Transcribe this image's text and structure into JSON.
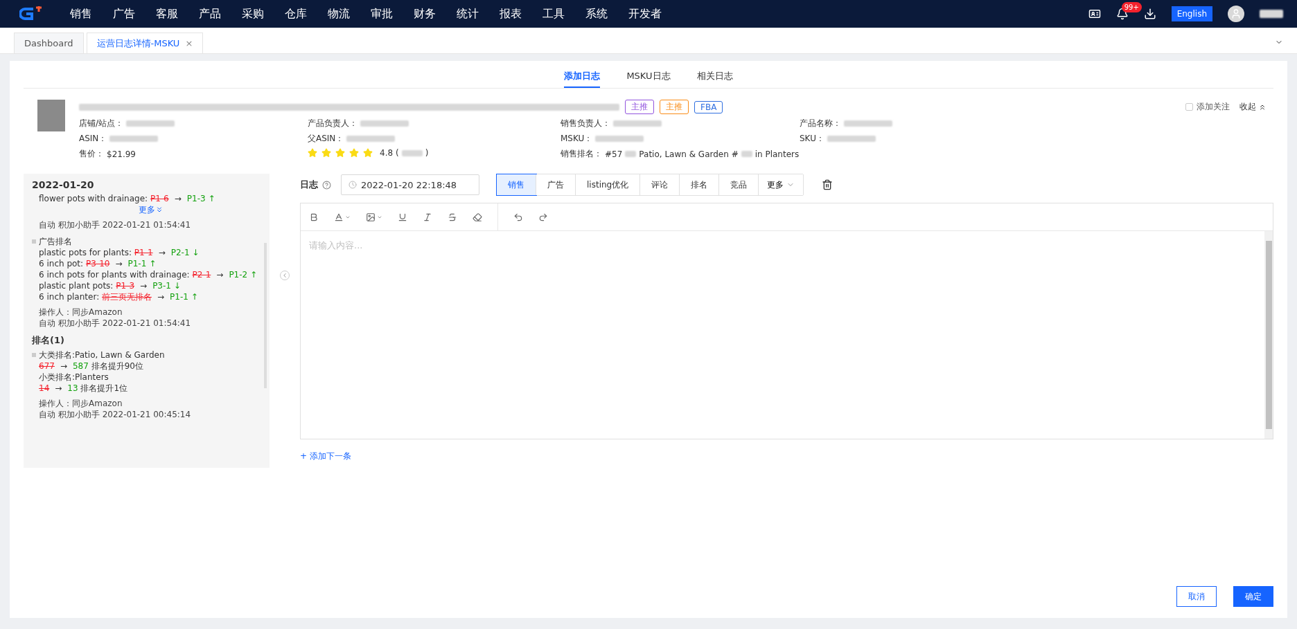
{
  "nav": {
    "menu": [
      "销售",
      "广告",
      "客服",
      "产品",
      "采购",
      "仓库",
      "物流",
      "审批",
      "财务",
      "统计",
      "报表",
      "工具",
      "系统",
      "开发者"
    ],
    "notification_badge": "99+",
    "language": "English"
  },
  "tabs": [
    {
      "label": "Dashboard",
      "selected": false,
      "closable": false
    },
    {
      "label": "运营日志详情-MSKU",
      "selected": true,
      "closable": true
    }
  ],
  "tab_close": "×",
  "subtabs": [
    {
      "label": "添加日志",
      "selected": true
    },
    {
      "label": "MSKU日志",
      "selected": false
    },
    {
      "label": "相关日志",
      "selected": false
    }
  ],
  "product": {
    "tags": [
      {
        "label": "主推",
        "color": "#9254de"
      },
      {
        "label": "主推",
        "color": "#fa8c16"
      },
      {
        "label": "FBA",
        "color": "#2f6fe0"
      }
    ],
    "follow": {
      "label": "添加关注",
      "checked": false
    },
    "collapse": "收起",
    "columns": [
      [
        {
          "label": "店铺/站点："
        },
        {
          "label": "ASIN："
        },
        {
          "label": "售价：",
          "value": "$21.99"
        }
      ],
      [
        {
          "label": "产品负责人："
        },
        {
          "label": "父ASIN："
        },
        {
          "kind": "rating",
          "stars": 5,
          "score": "4.8",
          "open": "(",
          "close": ")"
        }
      ],
      [
        {
          "label": "销售负责人："
        },
        {
          "label": "MSKU："
        },
        {
          "label": "销售排名：",
          "parts": [
            "#57",
            "Patio, Lawn & Garden #",
            "in Planters"
          ]
        }
      ],
      [
        {
          "label": "产品名称："
        },
        {
          "label": "SKU："
        }
      ]
    ]
  },
  "history": {
    "date": "2022-01-20",
    "groups": [
      {
        "lines": [
          {
            "label": "flower pots with drainage: ",
            "old": "P1-6",
            "arrow": "→",
            "new": "P1-3",
            "trend": "↑"
          }
        ],
        "more": "更多",
        "auto": "自动 积加小助手 2022-01-21 01:54:41"
      },
      {
        "title": "广告排名",
        "lines": [
          {
            "label": "plastic pots for plants: ",
            "old": "P1-1",
            "arrow": "→",
            "new": "P2-1",
            "trend": "↓"
          },
          {
            "label": "6 inch pot: ",
            "old": "P3-10",
            "arrow": "→",
            "new": "P1-1",
            "trend": "↑"
          },
          {
            "label": "6 inch pots for plants with drainage: ",
            "old": "P2-1",
            "arrow": "→",
            "new": "P1-2",
            "trend": "↑"
          },
          {
            "label": "plastic plant pots: ",
            "old": "P1-3",
            "arrow": "→",
            "new": "P3-1",
            "trend": "↓"
          },
          {
            "label": "6 inch planter: ",
            "old": "前三页无排名",
            "arrow": "→",
            "new": "P1-1",
            "trend": "↑"
          }
        ],
        "operator": "操作人：同步Amazon",
        "auto": "自动 积加小助手 2022-01-21 01:54:41"
      }
    ],
    "rank_title": "排名(1)",
    "ranks": [
      {
        "label": "大类排名:Patio, Lawn & Garden",
        "old": "677",
        "arrow": "→",
        "new": "587",
        "note": "排名提升90位"
      },
      {
        "label": "小类排名:Planters",
        "old": "14",
        "arrow": "→",
        "new": "13",
        "note": "排名提升1位"
      }
    ],
    "rank_operator": "操作人：同步Amazon",
    "rank_auto": "自动 积加小助手 2022-01-21 00:45:14"
  },
  "log": {
    "label": "日志",
    "datetime": "2022-01-20 22:18:48",
    "categories": [
      {
        "label": "销售",
        "selected": true
      },
      {
        "label": "广告",
        "selected": false
      },
      {
        "label": "listing优化",
        "selected": false
      },
      {
        "label": "评论",
        "selected": false
      },
      {
        "label": "排名",
        "selected": false
      },
      {
        "label": "竞品",
        "selected": false
      }
    ],
    "more": "更多",
    "placeholder": "请输入内容...",
    "add_next": "+ 添加下一条"
  },
  "buttons": [
    {
      "label": "取消",
      "kind": "secondary"
    },
    {
      "label": "确定",
      "kind": "primary"
    }
  ]
}
